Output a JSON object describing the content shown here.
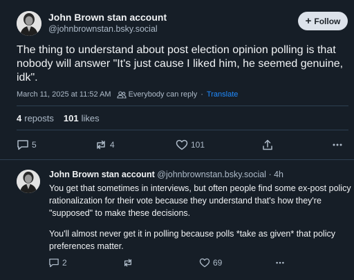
{
  "post": {
    "author_name": "John Brown stan account",
    "author_handle": "@johnbrownstan.bsky.social",
    "follow_label": "Follow",
    "text": "The thing to understand about post election opinion polling is that nobody will answer \"It's just cause I liked him, he seemed genuine, idk\".",
    "timestamp": "March 11, 2025 at 11:52 AM",
    "reply_setting": "Everybody can reply",
    "translate_label": "Translate",
    "reposts_count": "4",
    "reposts_label": "reposts",
    "likes_count": "101",
    "likes_label": "likes",
    "actions": {
      "replies": "5",
      "reposts": "4",
      "likes": "101"
    }
  },
  "reply": {
    "author_name": "John Brown stan account",
    "author_handle": "@johnbrownstan.bsky.social",
    "age": "· 4h",
    "paragraph1": "You get that sometimes in interviews, but often people find some ex-post policy rationalization for their vote because they understand that's how they're \"supposed\" to make these decisions.",
    "paragraph2": "You'll almost never get it in polling because polls *take as given* that policy preferences matter.",
    "actions": {
      "replies": "2",
      "likes": "69"
    }
  },
  "colors": {
    "background": "#161e27",
    "text": "#f1f3f5",
    "muted": "#aebbc9",
    "link": "#208bfe",
    "border": "#2e4052",
    "follow_bg": "#dce2ea"
  },
  "icons": [
    "avatar",
    "plus-icon",
    "people-icon",
    "reply-icon",
    "repost-icon",
    "like-icon",
    "share-icon",
    "more-icon"
  ]
}
